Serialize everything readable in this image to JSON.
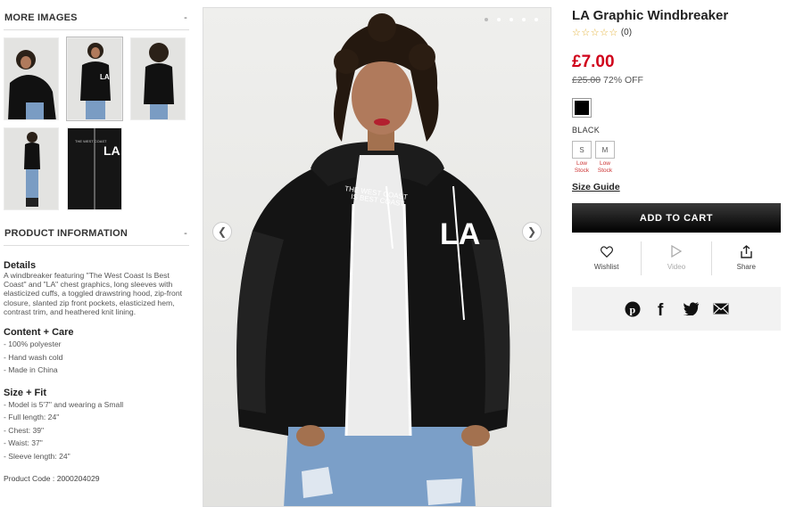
{
  "left": {
    "more_images_title": "MORE IMAGES",
    "more_images_toggle": "-",
    "product_info_title": "PRODUCT INFORMATION",
    "product_info_toggle": "-",
    "details_title": "Details",
    "details_text": "A windbreaker featuring \"The West Coast Is Best Coast\" and \"LA\" chest graphics, long sleeves with elasticized cuffs, a toggled drawstring hood, zip-front closure, slanted zip front pockets, elasticized hem, contrast trim, and heathered knit lining.",
    "content_title": "Content + Care",
    "content_items": [
      "- 100% polyester",
      "- Hand wash cold",
      "- Made in China"
    ],
    "size_fit_title": "Size + Fit",
    "size_fit_items": [
      "- Model is 5'7\" and wearing a Small",
      "- Full length: 24\"",
      "- Chest: 39\"",
      "- Waist: 37\"",
      "- Sleeve length: 24\""
    ],
    "product_code": "Product Code : 2000204029"
  },
  "product": {
    "title": "LA Graphic Windbreaker",
    "stars": "☆☆☆☆☆",
    "review_count": "(0)",
    "price": "£7.00",
    "original_price": "£25.00",
    "discount": "72% OFF",
    "color_name": "BLACK",
    "sizes": [
      {
        "label": "S",
        "stock": "Low Stock"
      },
      {
        "label": "M",
        "stock": "Low Stock"
      }
    ],
    "size_guide": "Size Guide",
    "add_to_cart": "ADD TO CART",
    "actions": {
      "wishlist": "Wishlist",
      "video": "Video",
      "share": "Share"
    }
  },
  "gallery": {
    "active_dot": 1,
    "dot_count": 5
  },
  "icons": [
    "heart-icon",
    "play-icon",
    "share-icon",
    "pinterest-icon",
    "facebook-icon",
    "twitter-icon",
    "email-icon",
    "chevron-left-icon",
    "chevron-right-icon"
  ],
  "colors": {
    "price_red": "#d0021b",
    "star_gold": "#e3b23a",
    "cart_black": "#000000"
  }
}
